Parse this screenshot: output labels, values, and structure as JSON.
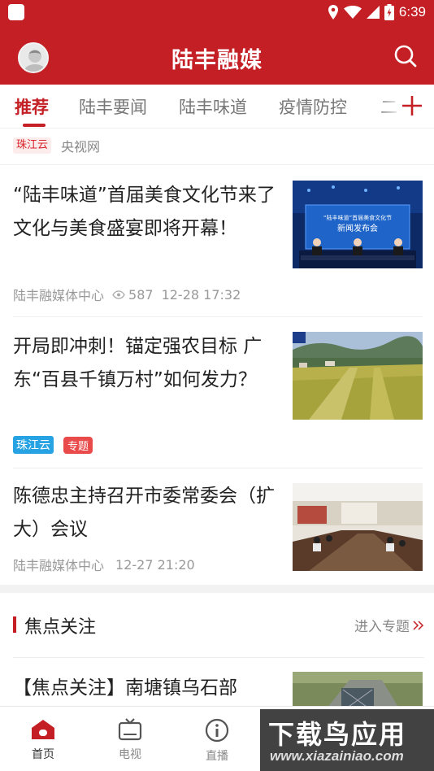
{
  "status_bar": {
    "time": "6:39",
    "icons": [
      "location-icon",
      "wifi-icon",
      "signal-icon",
      "battery-icon"
    ]
  },
  "app_bar": {
    "title": "陆丰融媒"
  },
  "tabs": [
    {
      "label": "推荐",
      "active": true
    },
    {
      "label": "陆丰要闻",
      "active": false
    },
    {
      "label": "陆丰味道",
      "active": false
    },
    {
      "label": "疫情防控",
      "active": false
    },
    {
      "label": "二",
      "active": false
    }
  ],
  "source_row": {
    "tag": "珠江云",
    "source": "央视网"
  },
  "articles": [
    {
      "title": "“陆丰味道”首届美食文化节来了 文化与美食盛宴即将开幕！",
      "source": "陆丰融媒体中心",
      "views": "587",
      "time": "12-28 17:32",
      "thumb_banner_line1": "“陆丰味道”首届美食文化节",
      "thumb_banner_line2": "新闻发布会"
    },
    {
      "title": "开局即冲刺！锚定强农目标 广东“百县千镇万村”如何发力？",
      "tags": [
        "珠江云",
        "专题"
      ]
    },
    {
      "title": "陈德忠主持召开市委常委会（扩大）会议",
      "source": "陆丰融媒体中心",
      "time": "12-27 21:20"
    }
  ],
  "focus_section": {
    "title": "焦点关注",
    "more": "进入专题",
    "article_title": "【焦点关注】南塘镇乌石部"
  },
  "bottom_nav": [
    {
      "label": "首页",
      "icon": "home-icon",
      "active": true
    },
    {
      "label": "电视",
      "icon": "tv-icon",
      "active": false
    },
    {
      "label": "直播",
      "icon": "info-icon",
      "active": false
    }
  ],
  "watermark": {
    "main": "下载鸟应用",
    "sub": "www.xiazainiao.com"
  },
  "colors": {
    "brand_red": "#c41f24",
    "tag_blue": "#27a3e3",
    "tag_red": "#e94a4a"
  }
}
